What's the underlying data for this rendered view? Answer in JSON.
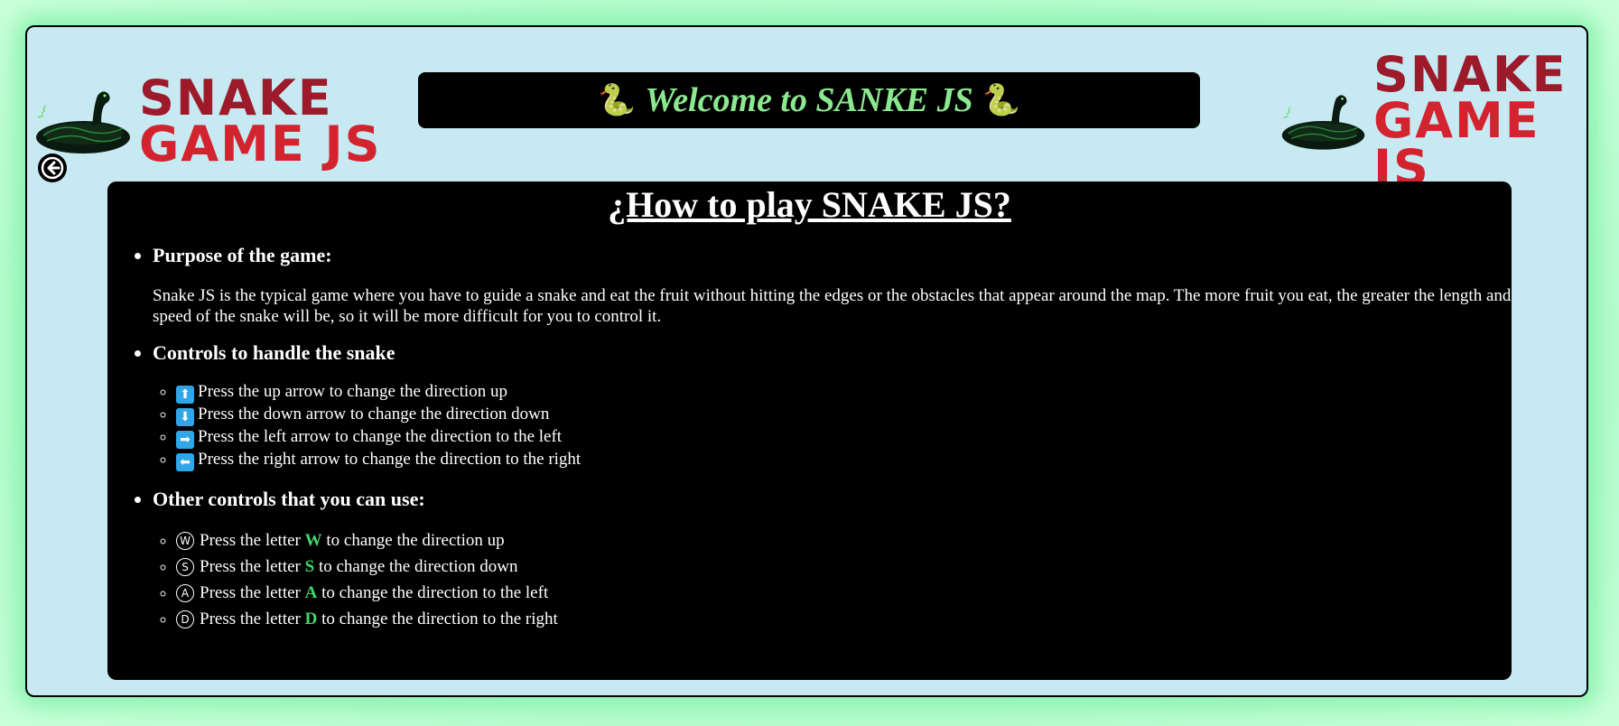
{
  "logo": {
    "line1": "SNAKE",
    "line2": "GAME JS"
  },
  "welcome": {
    "emoji_left": "🐍",
    "text": "Welcome to SANKE JS",
    "emoji_right": "🐍"
  },
  "back_icon": "arrow-left-circle-icon",
  "panel": {
    "title": "¿How to play SNAKE JS?",
    "sections": [
      {
        "heading": "Purpose of the game:",
        "text": "Snake JS is the typical game where you have to guide a snake and eat the fruit without hitting the edges or the obstacles that appear around the map. The more fruit you eat, the greater the length and speed of the snake will be, so it will be more difficult for you to control it."
      },
      {
        "heading": "Controls to handle the snake",
        "items": [
          {
            "key": "⬆",
            "text": "Press the up arrow to change the direction up"
          },
          {
            "key": "⬇",
            "text": "Press the down arrow to change the direction down"
          },
          {
            "key": "➡",
            "text": "Press the left arrow to change the direction to the left"
          },
          {
            "key": "⬅",
            "text": "Press the right arrow to change the direction to the right"
          }
        ]
      },
      {
        "heading": "Other controls that you can use:",
        "items": [
          {
            "key": "W",
            "pre": "Press the letter",
            "letter": "W",
            "post": "to change the direction up"
          },
          {
            "key": "S",
            "pre": "Press the letter",
            "letter": "S",
            "post": "to change the direction down"
          },
          {
            "key": "A",
            "pre": "Press the letter",
            "letter": "A",
            "post": "to change the direction to the left"
          },
          {
            "key": "D",
            "pre": "Press the letter",
            "letter": "D",
            "post": "to change the direction to the right"
          }
        ]
      }
    ]
  },
  "colors": {
    "frame_bg": "#c6e9f2",
    "glow": "#a6f7c0",
    "title_green": "#8be88f",
    "letter_green": "#3fd66a",
    "logo_dark_red": "#9c1a2a",
    "logo_red": "#d3232f"
  }
}
